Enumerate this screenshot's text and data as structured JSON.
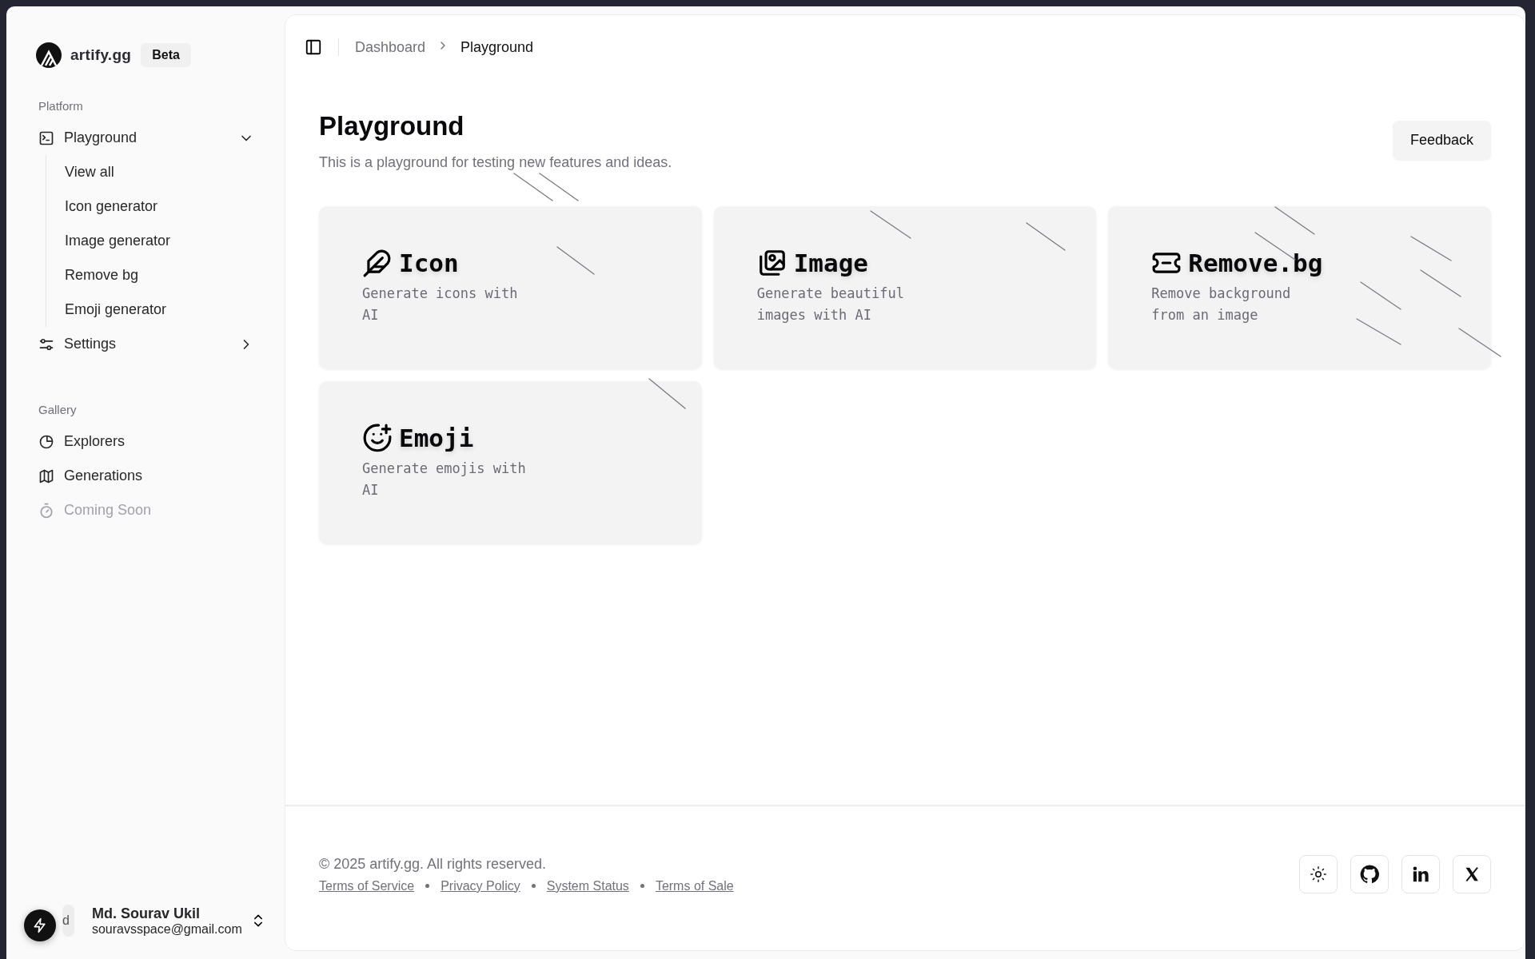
{
  "sidebar": {
    "brand": {
      "name": "artify.gg",
      "badge": "Beta"
    },
    "sections": [
      {
        "label": "Platform",
        "items": [
          {
            "label": "Playground",
            "expanded": true,
            "children": [
              {
                "label": "View all"
              },
              {
                "label": "Icon generator"
              },
              {
                "label": "Image generator"
              },
              {
                "label": "Remove bg"
              },
              {
                "label": "Emoji generator"
              }
            ]
          },
          {
            "label": "Settings",
            "expanded": false
          }
        ]
      },
      {
        "label": "Gallery",
        "items": [
          {
            "label": "Explorers",
            "disabled": false
          },
          {
            "label": "Generations",
            "disabled": false
          },
          {
            "label": "Coming Soon",
            "disabled": true
          }
        ]
      }
    ],
    "user": {
      "avatar": "d",
      "name": "Md. Sourav Ukil",
      "email": "souravsspace@gmail.com"
    }
  },
  "breadcrumb": [
    {
      "label": "Dashboard",
      "selected": false
    },
    {
      "label": "Playground",
      "selected": true
    }
  ],
  "page": {
    "title": "Playground",
    "subtitle": "This is a playground for testing new features and ideas.",
    "action": "Feedback"
  },
  "cards": [
    {
      "title": "Icon",
      "description": "Generate icons with AI"
    },
    {
      "title": "Image",
      "description": "Generate beautiful images with AI"
    },
    {
      "title": "Remove.bg",
      "description": "Remove background from an image"
    },
    {
      "title": "Emoji",
      "description": "Generate emojis with AI"
    }
  ],
  "footer": {
    "copyright": "© 2025 artify.gg. All rights reserved.",
    "links": [
      "Terms of Service",
      "Privacy Policy",
      "System Status",
      "Terms of Sale"
    ]
  }
}
